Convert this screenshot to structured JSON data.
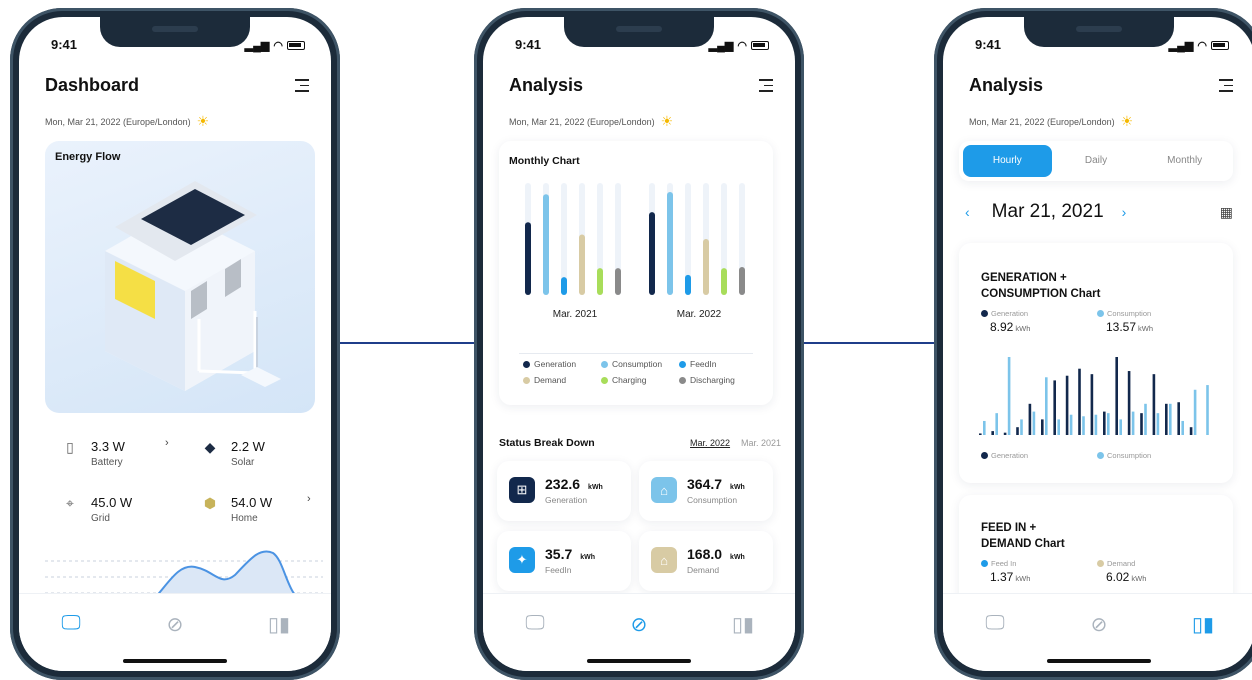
{
  "colors": {
    "accent": "#1e9be8",
    "navy": "#12284c",
    "connector": "#1f3d8a"
  },
  "status_time": "9:41",
  "phone1": {
    "title": "Dashboard",
    "date": "Mon, Mar 21, 2022 (Europe/London)",
    "energy_flow_title": "Energy Flow",
    "stats": [
      {
        "value": "3.3 W",
        "label": "Battery",
        "icon": "battery-icon"
      },
      {
        "value": "2.2 W",
        "label": "Solar",
        "icon": "solar-panel-icon"
      },
      {
        "value": "45.0 W",
        "label": "Grid",
        "icon": "grid-tower-icon"
      },
      {
        "value": "54.0 W",
        "label": "Home",
        "icon": "home-icon"
      }
    ],
    "active_tab": "dashboard"
  },
  "phone2": {
    "title": "Analysis",
    "date": "Mon, Mar 21, 2022 (Europe/London)",
    "monthly_chart_title": "Monthly Chart",
    "legend": [
      "Generation",
      "Consumption",
      "FeedIn",
      "Demand",
      "Charging",
      "Discharging"
    ],
    "status_breakdown_title": "Status Break Down",
    "years": [
      "Mar. 2022",
      "Mar. 2021"
    ],
    "tiles": [
      {
        "value": "232.6",
        "unit": "kWh",
        "label": "Generation"
      },
      {
        "value": "364.7",
        "unit": "kWh",
        "label": "Consumption"
      },
      {
        "value": "35.7",
        "unit": "kWh",
        "label": "FeedIn"
      },
      {
        "value": "168.0",
        "unit": "kWh",
        "label": "Demand"
      }
    ],
    "active_tab": "analysis"
  },
  "phone3": {
    "title": "Analysis",
    "date": "Mon, Mar 21, 2022 (Europe/London)",
    "segments": [
      "Hourly",
      "Daily",
      "Monthly"
    ],
    "selected_segment": "Hourly",
    "selected_date": "Mar 21, 2021",
    "gen_chart_title_1": "GENERATION +",
    "gen_chart_title_2": "CONSUMPTION Chart",
    "gen_label": "Generation",
    "gen_value": "8.92",
    "gen_unit": "kWh",
    "cons_label": "Consumption",
    "cons_value": "13.57",
    "cons_unit": "kWh",
    "feed_chart_title_1": "FEED IN +",
    "feed_chart_title_2": "DEMAND Chart",
    "feed_label": "Feed In",
    "feed_value": "1.37",
    "feed_unit": "kWh",
    "demand_label": "Demand",
    "demand_value": "6.02",
    "demand_unit": "kWh",
    "active_tab": "reports"
  },
  "chart_data": [
    {
      "type": "bar",
      "title": "Monthly Chart",
      "categories": [
        "Mar. 2021",
        "Mar. 2022"
      ],
      "series": [
        {
          "name": "Generation",
          "color": "#12284c",
          "values": [
            0.65,
            0.74
          ]
        },
        {
          "name": "Consumption",
          "color": "#7cc4ea",
          "values": [
            0.9,
            0.92
          ]
        },
        {
          "name": "FeedIn",
          "color": "#1e9be8",
          "values": [
            0.16,
            0.18
          ]
        },
        {
          "name": "Demand",
          "color": "#d8cba4",
          "values": [
            0.54,
            0.5
          ]
        },
        {
          "name": "Charging",
          "color": "#a8dd5a",
          "values": [
            0.24,
            0.24
          ]
        },
        {
          "name": "Discharging",
          "color": "#8a8a8a",
          "values": [
            0.24,
            0.25
          ]
        }
      ],
      "ylim": [
        0,
        1
      ]
    },
    {
      "type": "bar",
      "title": "GENERATION + CONSUMPTION Chart",
      "series": [
        {
          "name": "Generation",
          "color": "#12284c",
          "values": [
            0.02,
            0.05,
            0.03,
            0.1,
            0.4,
            0.2,
            0.7,
            0.76,
            0.85,
            0.78,
            0.3,
            1.0,
            0.82,
            0.28,
            0.78,
            0.4,
            0.42,
            0.1,
            0.0
          ]
        },
        {
          "name": "Consumption",
          "color": "#7cc4ea",
          "values": [
            0.18,
            0.28,
            1.0,
            0.2,
            0.3,
            0.74,
            0.2,
            0.26,
            0.24,
            0.26,
            0.28,
            0.2,
            0.3,
            0.4,
            0.28,
            0.4,
            0.18,
            0.58,
            0.64
          ]
        }
      ],
      "ylim": [
        0,
        1
      ]
    }
  ]
}
